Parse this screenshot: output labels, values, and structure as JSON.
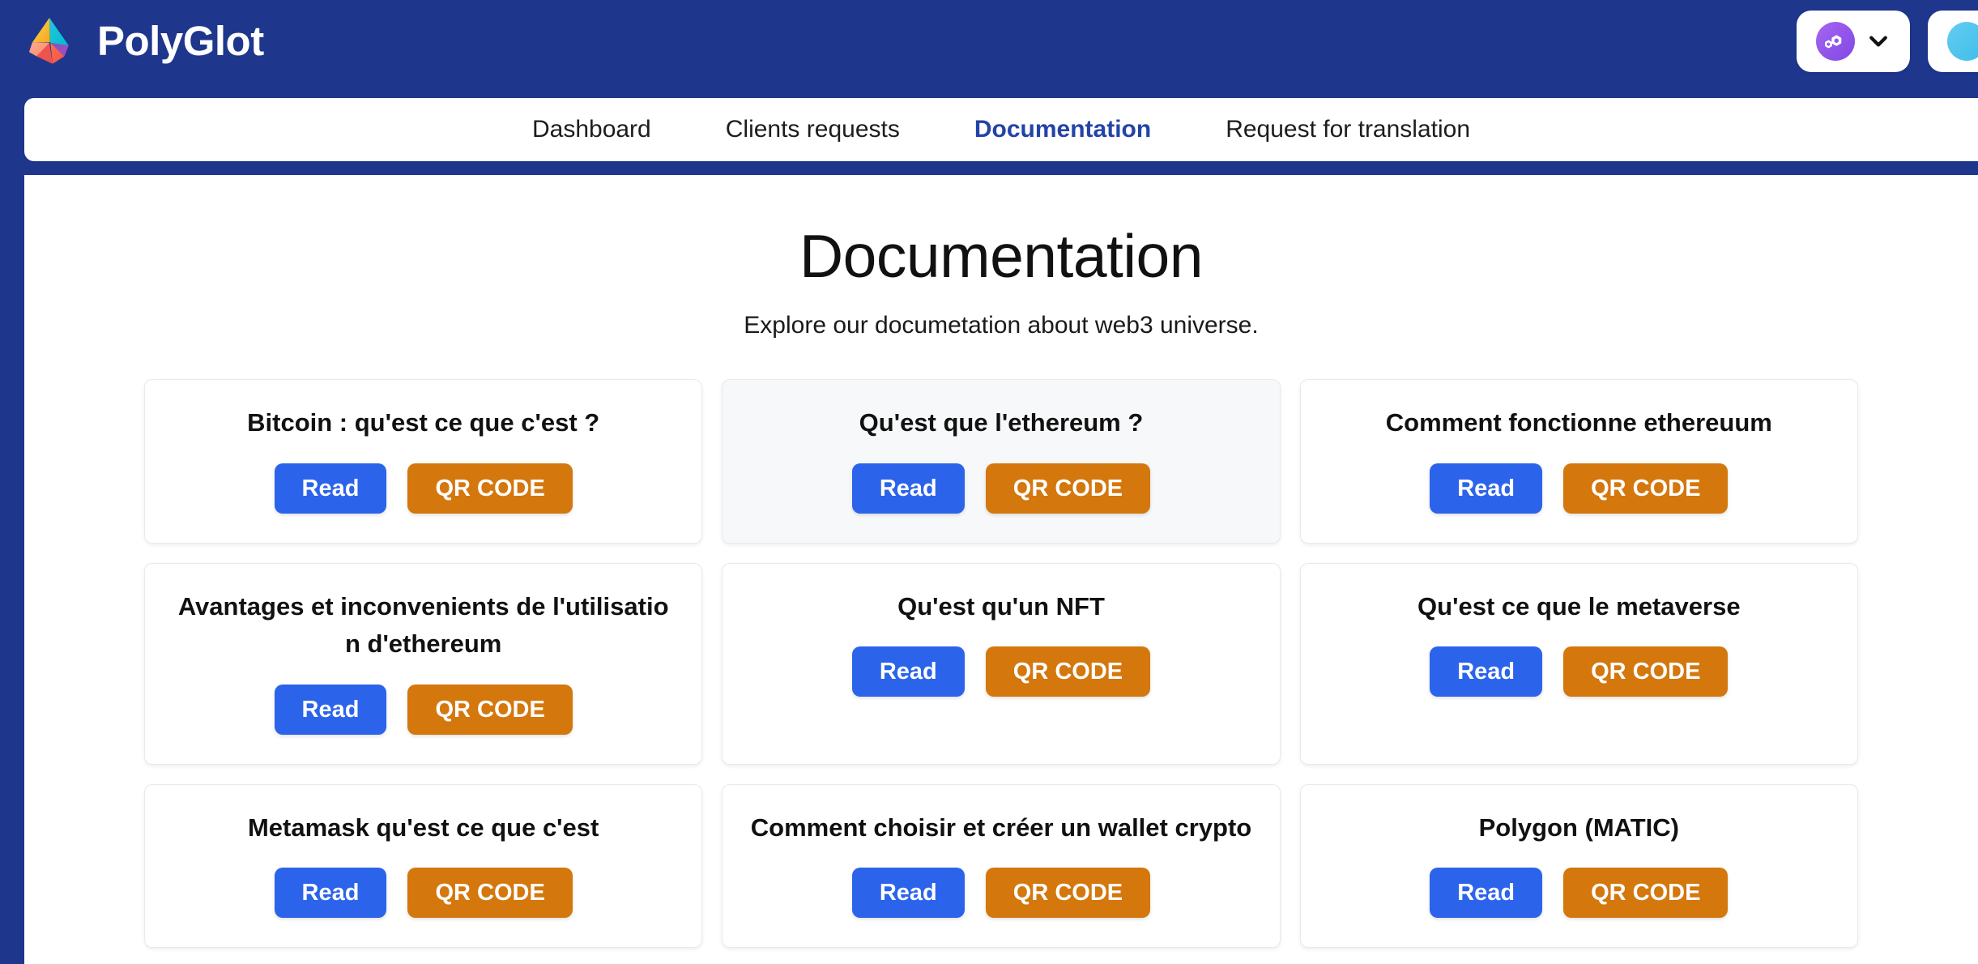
{
  "brand": {
    "name": "PolyGlot",
    "logo_icon": "polyglot-pyramid-logo"
  },
  "header": {
    "network_button": {
      "icon": "polygon-matic-icon",
      "chevron_icon": "chevron-down-icon"
    },
    "wallet_button": {
      "icon": "wallet-avatar-icon"
    }
  },
  "nav": {
    "items": [
      {
        "label": "Dashboard",
        "active": false
      },
      {
        "label": "Clients requests",
        "active": false
      },
      {
        "label": "Documentation",
        "active": true
      },
      {
        "label": "Request for translation",
        "active": false
      }
    ]
  },
  "main": {
    "title": "Documentation",
    "subtitle": "Explore our documetation about web3 universe.",
    "read_label": "Read",
    "qr_label": "QR CODE",
    "cards": [
      {
        "title": "Bitcoin : qu'est ce que c'est ?",
        "hovered": false
      },
      {
        "title": "Qu'est que l'ethereum ?",
        "hovered": true
      },
      {
        "title": "Comment fonctionne ethereuum",
        "hovered": false
      },
      {
        "title": "Avantages et inconvenients de l'utilisation d'ethereum",
        "hovered": false
      },
      {
        "title": "Qu'est qu'un NFT",
        "hovered": false
      },
      {
        "title": "Qu'est ce que le metaverse",
        "hovered": false
      },
      {
        "title": "Metamask qu'est ce que c'est",
        "hovered": false
      },
      {
        "title": "Comment choisir et créer un wallet crypto",
        "hovered": false
      },
      {
        "title": "Polygon (MATIC)",
        "hovered": false
      }
    ]
  },
  "colors": {
    "header_blue": "#1e368c",
    "nav_active": "#2343a8",
    "read_button": "#2b63eb",
    "qr_button": "#d4770d",
    "card_hover_bg": "#f7f8fa"
  }
}
